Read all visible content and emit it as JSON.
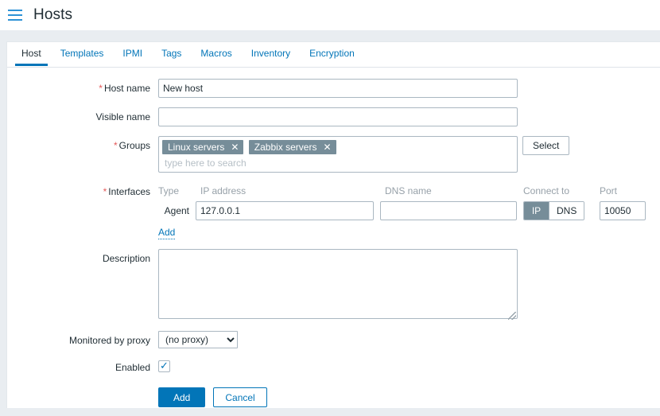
{
  "header": {
    "title": "Hosts",
    "menu_icon": "hamburger-icon"
  },
  "tabs": [
    {
      "label": "Host",
      "selected": true
    },
    {
      "label": "Templates",
      "selected": false
    },
    {
      "label": "IPMI",
      "selected": false
    },
    {
      "label": "Tags",
      "selected": false
    },
    {
      "label": "Macros",
      "selected": false
    },
    {
      "label": "Inventory",
      "selected": false
    },
    {
      "label": "Encryption",
      "selected": false
    }
  ],
  "form": {
    "host_name": {
      "label": "Host name",
      "required": true,
      "value": "New host",
      "placeholder": ""
    },
    "visible_name": {
      "label": "Visible name",
      "required": false,
      "value": "",
      "placeholder": ""
    },
    "groups": {
      "label": "Groups",
      "required": true,
      "chips": [
        {
          "label": "Linux servers",
          "remove_icon": "close-icon"
        },
        {
          "label": "Zabbix servers",
          "remove_icon": "close-icon"
        }
      ],
      "search_value": "",
      "search_placeholder": "type here to search",
      "select_button": "Select"
    },
    "interfaces": {
      "label": "Interfaces",
      "required": true,
      "columns": [
        "Type",
        "IP address",
        "DNS name",
        "Connect to",
        "Port"
      ],
      "rows": [
        {
          "type": "Agent",
          "ip_address": "127.0.0.1",
          "dns_name": "",
          "connect_to_options": [
            "IP",
            "DNS"
          ],
          "connect_to_selected": "IP",
          "port": "10050"
        }
      ],
      "add_link": "Add"
    },
    "description": {
      "label": "Description",
      "required": false,
      "value": "",
      "placeholder": ""
    },
    "monitored_by_proxy": {
      "label": "Monitored by proxy",
      "required": false,
      "selected": "(no proxy)",
      "options": [
        "(no proxy)"
      ]
    },
    "enabled": {
      "label": "Enabled",
      "required": false,
      "checked": true,
      "check_icon": "check-icon"
    }
  },
  "actions": {
    "submit_label": "Add",
    "cancel_label": "Cancel"
  },
  "colors": {
    "accent": "#0275b8",
    "chip_bg": "#768d99",
    "required_star": "#e45959",
    "page_bg": "#e9edf1",
    "muted_text": "#97a1a9"
  }
}
